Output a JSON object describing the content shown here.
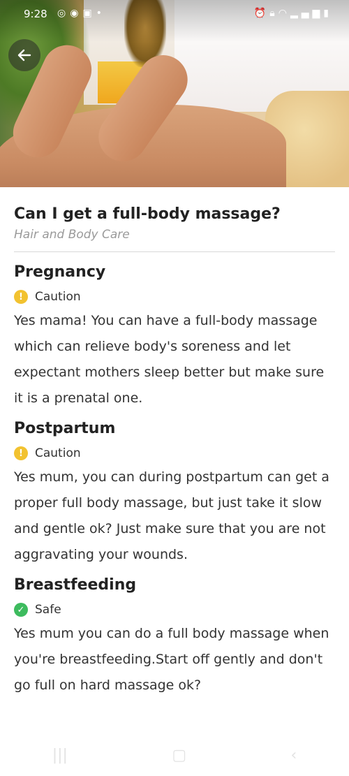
{
  "status_bar": {
    "time": "9:28",
    "left_icons": [
      "instagram-icon",
      "app-icon",
      "image-icon",
      "dot-icon"
    ],
    "right_icons": [
      "alarm-icon",
      "lock-icon",
      "wifi-icon",
      "signal-icon",
      "battery-icon"
    ]
  },
  "article": {
    "title": "Can I get a full-body massage?",
    "category": "Hair and Body Care"
  },
  "sections": [
    {
      "heading": "Pregnancy",
      "status": "Caution",
      "status_color": "#f2c230",
      "text": "Yes mama! You can have a full-body massage which can relieve body's soreness and let expectant mothers sleep better but make sure it is a prenatal one."
    },
    {
      "heading": "Postpartum",
      "status": "Caution",
      "status_color": "#f2c230",
      "text": "Yes mum, you can during postpartum can get a proper full body massage, but just take it slow and gentle ok? Just make sure that you are not aggravating your wounds."
    },
    {
      "heading": "Breastfeeding",
      "status": "Safe",
      "status_color": "#3dbb5e",
      "text": "Yes mum you can do a full body massage when you're breastfeeding.Start off gently and don't go full on hard massage ok?"
    }
  ],
  "navbar": {
    "icons": [
      "recent-apps-icon",
      "home-icon",
      "back-nav-icon"
    ]
  }
}
